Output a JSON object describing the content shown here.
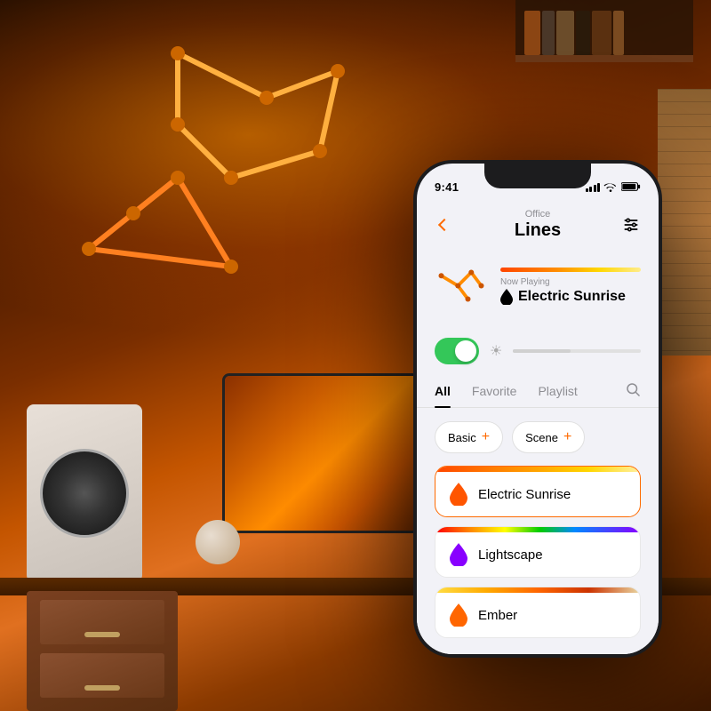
{
  "background": {
    "description": "Office room with warm orange lighting and geometric light strips on wall"
  },
  "phone": {
    "status_bar": {
      "time": "9:41",
      "signal_label": "signal",
      "wifi_label": "wifi",
      "battery_label": "battery"
    },
    "header": {
      "back_label": "back",
      "subtitle": "Office",
      "title": "Lines",
      "settings_label": "settings"
    },
    "now_playing": {
      "label": "Now Playing",
      "scene_name": "Electric Sunrise",
      "gradient": "electric-sunrise"
    },
    "toggle": {
      "is_on": true,
      "brightness_percent": 45
    },
    "tabs": [
      {
        "id": "all",
        "label": "All",
        "active": true
      },
      {
        "id": "favorite",
        "label": "Favorite",
        "active": false
      },
      {
        "id": "playlist",
        "label": "Playlist",
        "active": false
      }
    ],
    "categories": [
      {
        "id": "basic",
        "label": "Basic"
      },
      {
        "id": "scene",
        "label": "Scene"
      }
    ],
    "scenes": [
      {
        "id": "electric-sunrise",
        "name": "Electric Sunrise",
        "active": true,
        "gradient_colors": [
          "#ff4500",
          "#ff8c00",
          "#ffd700",
          "#ffec8a"
        ]
      },
      {
        "id": "lightscape",
        "name": "Lightscape",
        "active": false,
        "gradient_colors": [
          "#ff0000",
          "#ff8800",
          "#ffff00",
          "#00cc00",
          "#0000ff",
          "#8800ff"
        ]
      },
      {
        "id": "ember",
        "name": "Ember",
        "active": false,
        "gradient_colors": [
          "#ffcc00",
          "#ff8800",
          "#ff5500",
          "#cc4400",
          "#e8d0a0"
        ]
      }
    ]
  }
}
